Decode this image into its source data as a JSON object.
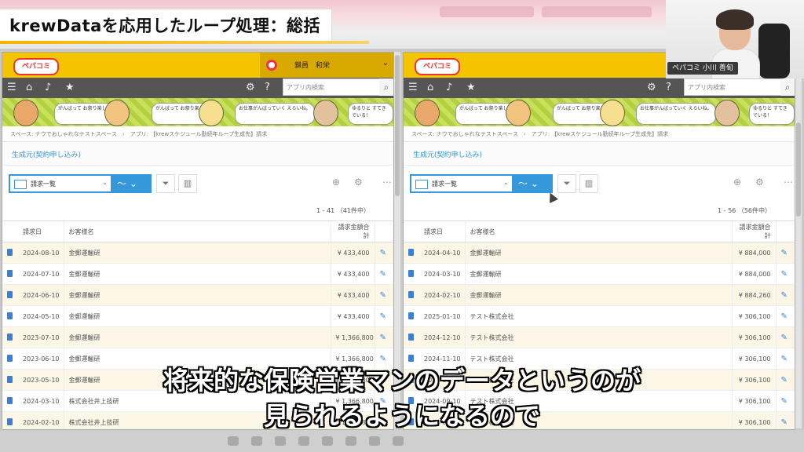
{
  "video": {
    "title": "krewDataを応用したループ処理：総括",
    "captions": [
      "将来的な保険営業マンのデータというのが",
      "見られるようになるので"
    ],
    "presenter_label": "ペパコミ 小川 善旬"
  },
  "app": {
    "logo_text": "ペパコミ",
    "user_name": "鎖員　和栄",
    "search_placeholder": "アプリ内検索",
    "breadcrumb": "スペース: ナウでおしゃれなテストスペース　›　アプリ: 【krewスケジュール勤続年ループ生成先】請求",
    "app_name": "生成元(契約申し込み)",
    "view_name": "請求一覧",
    "banner_bubbles": [
      "がんばって\nお祭り楽しいよ！",
      "お仕事がんばっていく\nえらいね。",
      "ゆるりと\nすてきでいる！"
    ],
    "columns": [
      "請求日",
      "お客様名",
      "請求金額合計"
    ]
  },
  "left_panel": {
    "count": "1 - 41 （41件中）",
    "rows": [
      {
        "date": "2024-08-10",
        "customer": "金郵運輸研",
        "amount": "¥ 433,400"
      },
      {
        "date": "2024-07-10",
        "customer": "金郵運輸研",
        "amount": "¥ 433,400"
      },
      {
        "date": "2024-06-10",
        "customer": "金郵運輸研",
        "amount": "¥ 433,400"
      },
      {
        "date": "2024-05-10",
        "customer": "金郵運輸研",
        "amount": "¥ 433,400"
      },
      {
        "date": "2023-07-10",
        "customer": "金郵運輸研",
        "amount": "¥ 1,366,800"
      },
      {
        "date": "2023-06-10",
        "customer": "金郵運輸研",
        "amount": "¥ 1,366,800"
      },
      {
        "date": "2023-05-10",
        "customer": "金郵運輸研",
        "amount": "¥ 1,366,800"
      },
      {
        "date": "2024-03-10",
        "customer": "株式会社井上技研",
        "amount": "¥ 1,366,800"
      },
      {
        "date": "2024-02-10",
        "customer": "株式会社井上技研",
        "amount": "¥ 1,366,800"
      }
    ]
  },
  "right_panel": {
    "count": "1 - 56 （56件中）",
    "rows": [
      {
        "date": "2024-04-10",
        "customer": "金郵運輸研",
        "amount": "¥ 884,000"
      },
      {
        "date": "2024-03-10",
        "customer": "金郵運輸研",
        "amount": "¥ 884,000"
      },
      {
        "date": "2024-02-10",
        "customer": "金郵運輸研",
        "amount": "¥ 884,260"
      },
      {
        "date": "2025-01-10",
        "customer": "テスト株式会社",
        "amount": "¥ 306,100"
      },
      {
        "date": "2024-12-10",
        "customer": "テスト株式会社",
        "amount": "¥ 306,100"
      },
      {
        "date": "2024-11-10",
        "customer": "テスト株式会社",
        "amount": "¥ 306,100"
      },
      {
        "date": "2024-10-10",
        "customer": "テスト株式会社",
        "amount": "¥ 306,100"
      },
      {
        "date": "2024-09-10",
        "customer": "テスト株式会社",
        "amount": "¥ 306,100"
      },
      {
        "date": "2024-08-10",
        "customer": "テスト株式会社",
        "amount": "¥ 306,100"
      }
    ]
  },
  "colors": {
    "accent_yellow": "#f5c400",
    "kintone_blue": "#3498db",
    "nav_gray": "#555555"
  }
}
